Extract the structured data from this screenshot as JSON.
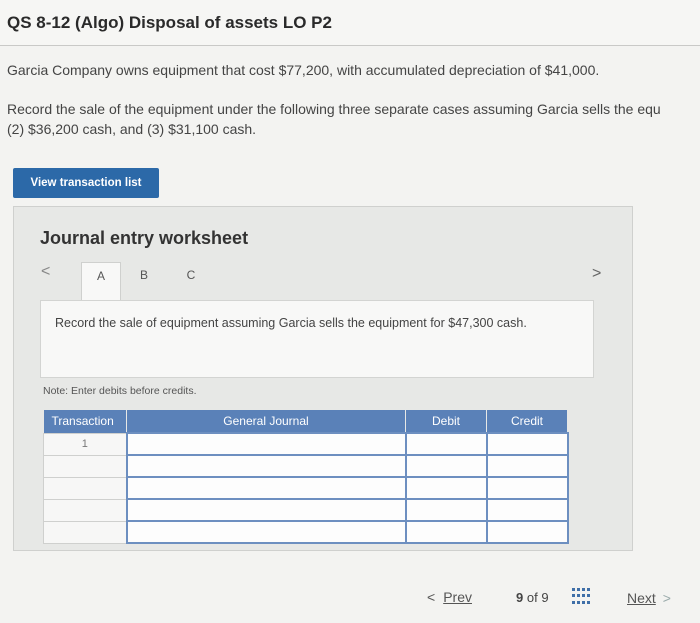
{
  "question": {
    "title": "QS 8-12 (Algo) Disposal of assets LO P2",
    "intro": "Garcia Company owns equipment that cost $77,200, with accumulated depreciation of $41,000.",
    "instruction_line1": "Record the sale of the equipment under the following three separate cases assuming Garcia sells the equ",
    "instruction_line2": "(2) $36,200 cash, and (3) $31,100 cash."
  },
  "toolbar": {
    "view_transaction_list": "View transaction list"
  },
  "worksheet": {
    "title": "Journal entry worksheet",
    "prev_arrow": "<",
    "next_arrow": ">",
    "tabs": [
      "A",
      "B",
      "C"
    ],
    "active_tab": "A",
    "prompt": "Record the sale of equipment assuming Garcia sells the equipment for $47,300 cash.",
    "note": "Note: Enter debits before credits."
  },
  "journal": {
    "headers": {
      "transaction": "Transaction",
      "general_journal": "General Journal",
      "debit": "Debit",
      "credit": "Credit"
    },
    "first_row_transaction": "1"
  },
  "footer": {
    "prev_label": "Prev",
    "prev_chevron": "<",
    "page_current": "9",
    "page_of": "of",
    "page_total": "9",
    "next_label": "Next",
    "next_chevron": ">"
  }
}
